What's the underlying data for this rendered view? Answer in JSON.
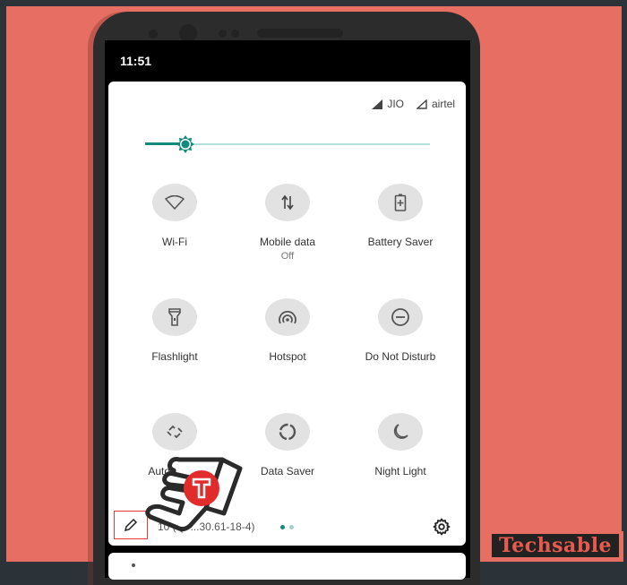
{
  "status_bar": {
    "time": "11:51"
  },
  "carriers": [
    {
      "name": "JIO",
      "icon": "signal-full-icon"
    },
    {
      "name": "airtel",
      "icon": "signal-outline-icon"
    }
  ],
  "brightness": {
    "level": 0.14,
    "accent": "#138b7c",
    "track": "#b3dfdb"
  },
  "tiles": [
    {
      "label": "Wi-Fi",
      "sub": "",
      "icon": "wifi-icon"
    },
    {
      "label": "Mobile data",
      "sub": "Off",
      "icon": "mobile-data-icon"
    },
    {
      "label": "Battery Saver",
      "sub": "",
      "icon": "battery-saver-icon"
    },
    {
      "label": "Flashlight",
      "sub": "",
      "icon": "flashlight-icon"
    },
    {
      "label": "Hotspot",
      "sub": "",
      "icon": "hotspot-icon"
    },
    {
      "label": "Do Not Disturb",
      "sub": "",
      "icon": "do-not-disturb-icon"
    },
    {
      "label": "Auto-rotate",
      "sub": "",
      "icon": "auto-rotate-icon"
    },
    {
      "label": "Data Saver",
      "sub": "",
      "icon": "data-saver-icon"
    },
    {
      "label": "Night Light",
      "sub": "",
      "icon": "night-light-icon"
    }
  ],
  "footer": {
    "build": "10 (QP...30.61-18-4)",
    "page_dots": [
      {
        "color": "#138b7c"
      },
      {
        "color": "#9fd4ce"
      }
    ],
    "edit_icon": "pencil-icon",
    "settings_icon": "gear-icon"
  },
  "watermark": {
    "text": "Techsable"
  }
}
